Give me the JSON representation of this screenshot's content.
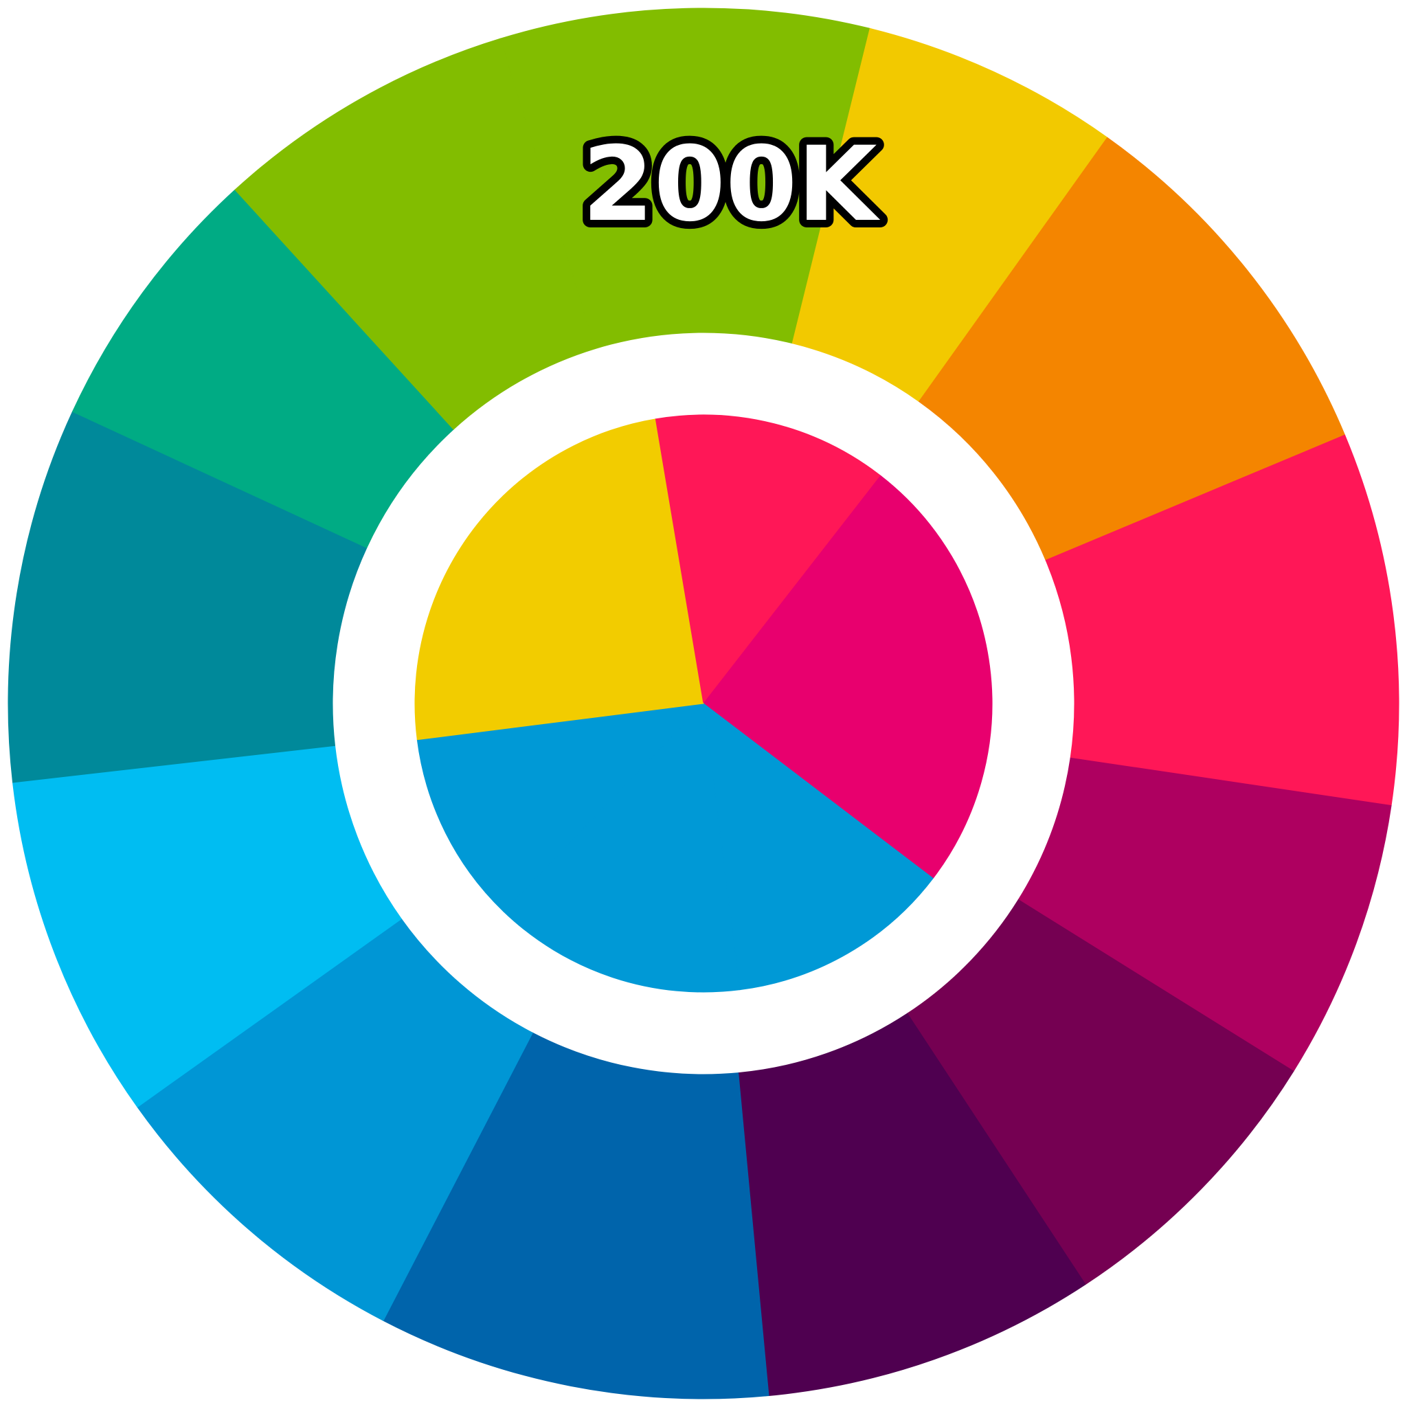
{
  "chart_data": {
    "type": "pie",
    "title": "",
    "rings": [
      {
        "name": "",
        "values": [
          9.57,
          13.17,
          24.84,
          12.63,
          14.2,
          10.81,
          14.78
        ],
        "colors": [
          "#F2CC00",
          "#FF1757",
          "#E8006E",
          "#0099D6",
          "#0099D6",
          "#0099D6",
          "#F2CC00"
        ]
      },
      {
        "name": "",
        "values": [
          11.98,
          8.41,
          12.34,
          12.1,
          9.12,
          9.61,
          10.85,
          12.74,
          10.52,
          11.25,
          12.17,
          8.86,
          9.85
        ],
        "colors": [
          "#82BD00",
          "#F2C900",
          "#F48500",
          "#FF1757",
          "#AE0060",
          "#750052",
          "#4F0050",
          "#0064AB",
          "#0096D5",
          "#00BDF2",
          "#00899A",
          "#00AB84",
          "#82BD00"
        ]
      }
    ],
    "data_labels": [
      {
        "text": "200K"
      }
    ]
  }
}
